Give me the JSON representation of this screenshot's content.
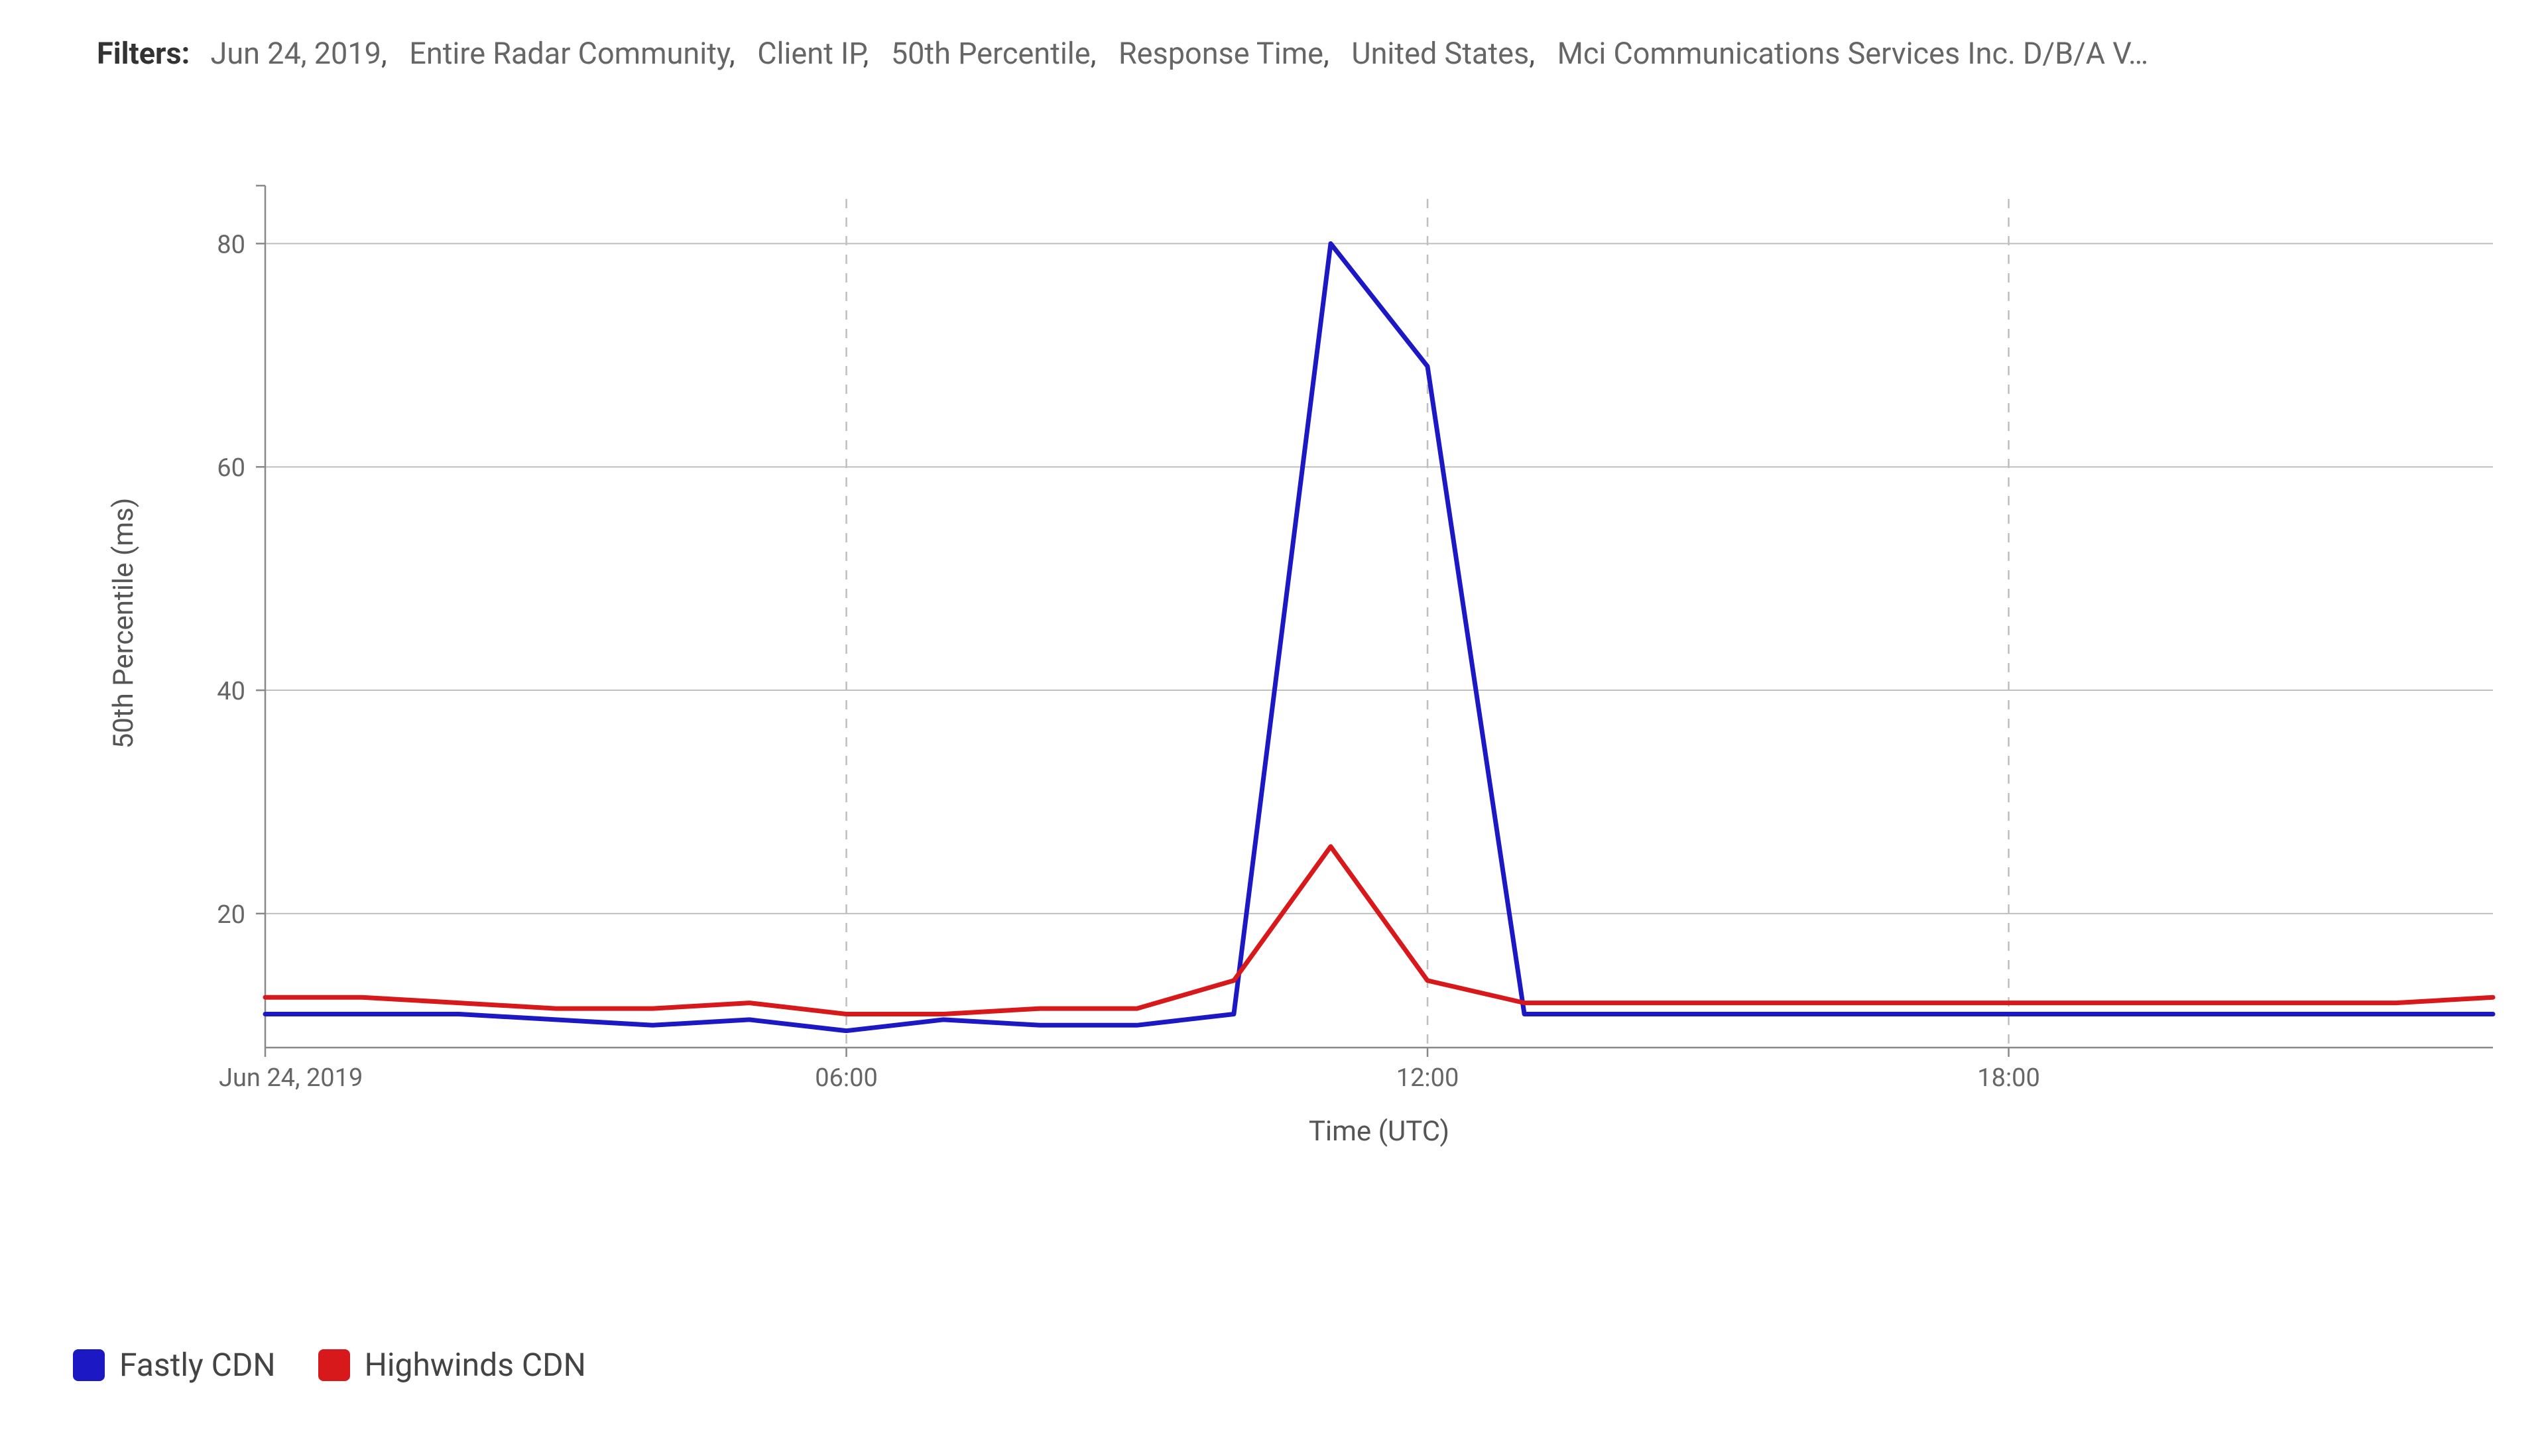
{
  "filters": {
    "label": "Filters:",
    "chips": [
      "Jun 24, 2019",
      "Entire Radar Community",
      "Client IP",
      "50th Percentile",
      "Response Time",
      "United States",
      "Mci Communications Services Inc. D/B/A V…"
    ]
  },
  "legend": [
    {
      "name": "Fastly CDN",
      "color": "#1b18c4"
    },
    {
      "name": "Highwinds CDN",
      "color": "#d7191c"
    }
  ],
  "chart_data": {
    "type": "line",
    "title": "",
    "xlabel": "Time (UTC)",
    "ylabel": "50th Percentile (ms)",
    "ylim": [
      8,
      84
    ],
    "x": [
      0,
      1,
      2,
      3,
      4,
      5,
      6,
      7,
      8,
      9,
      10,
      11,
      12,
      13,
      14,
      15,
      16,
      17,
      18,
      19,
      20,
      21,
      22,
      23
    ],
    "x_tick_positions": [
      0,
      6,
      12,
      18
    ],
    "x_tick_labels": [
      "Jun 24, 2019",
      "06:00",
      "12:00",
      "18:00"
    ],
    "y_ticks": [
      20,
      40,
      60,
      80
    ],
    "series": [
      {
        "name": "Fastly CDN",
        "color": "#1b18c4",
        "values": [
          11,
          11,
          11,
          10.5,
          10,
          10.5,
          9.5,
          10.5,
          10,
          10,
          11,
          80,
          69,
          11,
          11,
          11,
          11,
          11,
          11,
          11,
          11,
          11,
          11,
          11
        ]
      },
      {
        "name": "Highwinds CDN",
        "color": "#d7191c",
        "values": [
          12.5,
          12.5,
          12,
          11.5,
          11.5,
          12,
          11,
          11,
          11.5,
          11.5,
          14,
          26,
          14,
          12,
          12,
          12,
          12,
          12,
          12,
          12,
          12,
          12,
          12,
          12.5
        ]
      }
    ]
  }
}
